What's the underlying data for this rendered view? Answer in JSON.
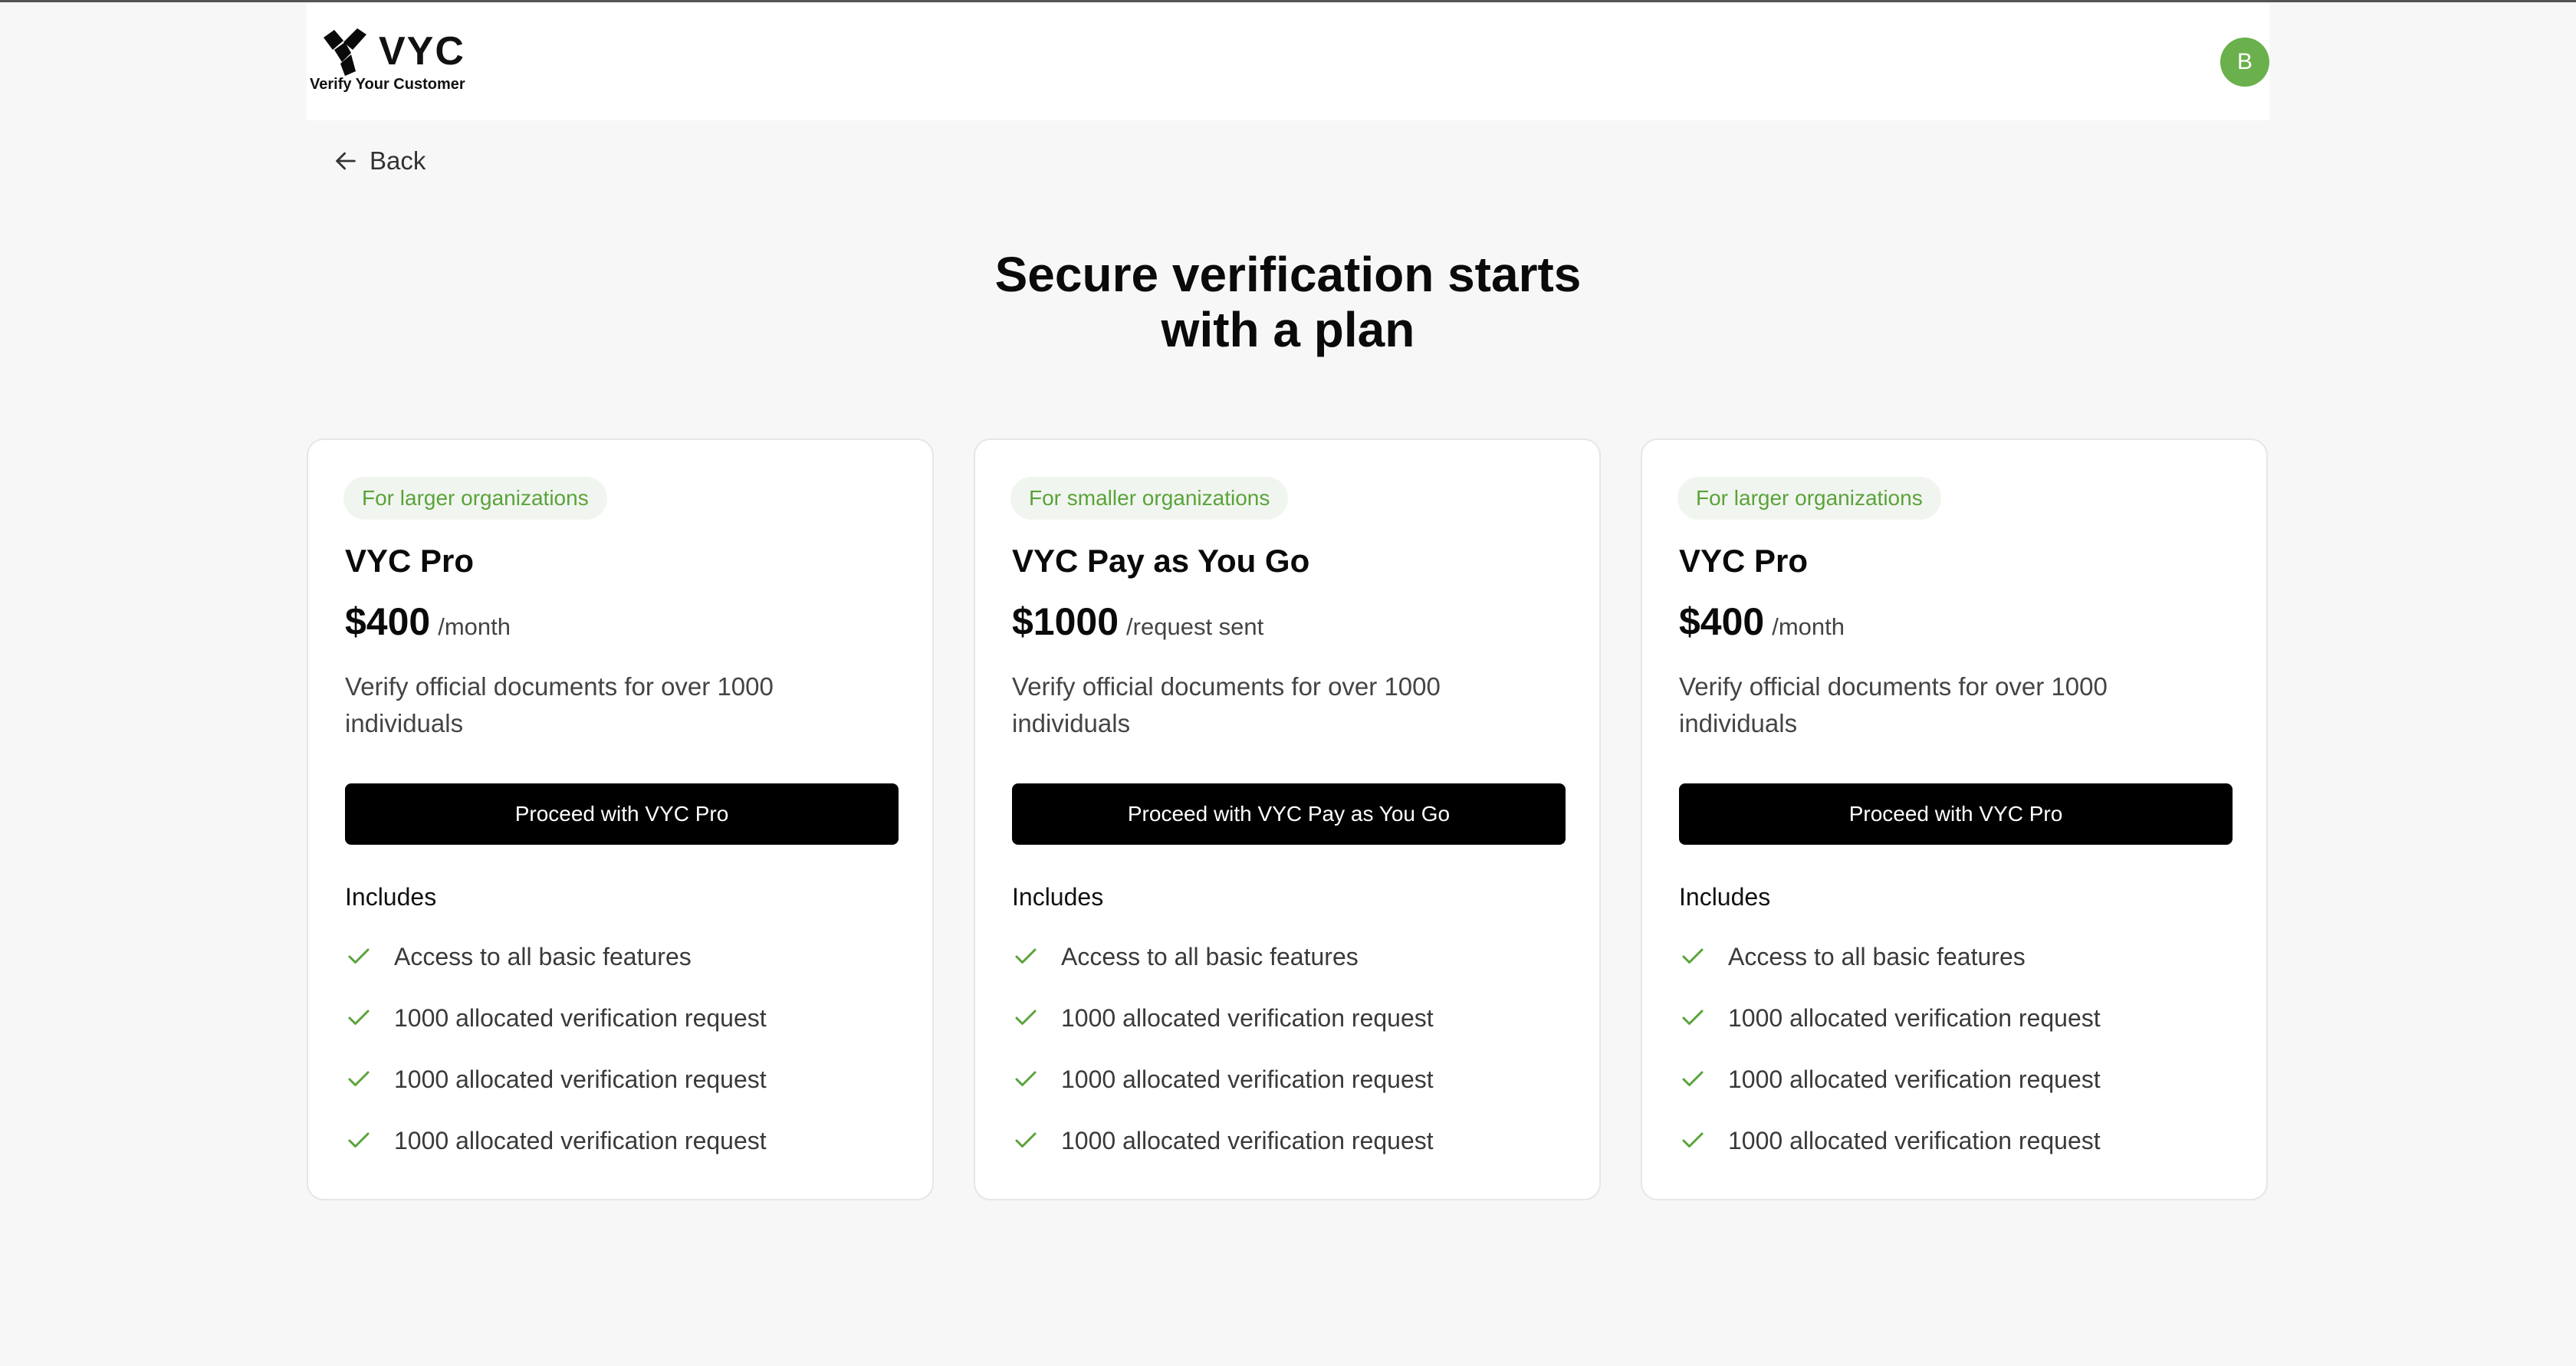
{
  "header": {
    "logo_text": "VYC",
    "tagline": "Verify Your Customer",
    "avatar_initial": "B"
  },
  "nav": {
    "back_label": "Back"
  },
  "page": {
    "title_line1": "Secure verification starts",
    "title_line2": "with a plan"
  },
  "colors": {
    "accent_green": "#6ab04c",
    "badge_text": "#5aa33a",
    "badge_bg": "#f1f5ef",
    "button_bg": "#000000"
  },
  "plans": [
    {
      "badge": "For larger organizations",
      "name": "VYC Pro",
      "price": "$400",
      "period": "/month",
      "description": "Verify official documents for over 1000 individuals",
      "cta": "Proceed with VYC Pro",
      "includes_title": "Includes",
      "features": [
        "Access to all basic features",
        "1000 allocated verification request",
        "1000 allocated verification request",
        "1000 allocated verification request"
      ]
    },
    {
      "badge": "For smaller organizations",
      "name": "VYC Pay as You Go",
      "price": "$1000",
      "period": "/request sent",
      "description": "Verify official documents for over 1000 individuals",
      "cta": "Proceed with VYC Pay as You Go",
      "includes_title": "Includes",
      "features": [
        "Access to all basic features",
        "1000 allocated verification request",
        "1000 allocated verification request",
        "1000 allocated verification request"
      ]
    },
    {
      "badge": "For larger organizations",
      "name": "VYC Pro",
      "price": "$400",
      "period": "/month",
      "description": "Verify official documents for over 1000 individuals",
      "cta": "Proceed with VYC Pro",
      "includes_title": "Includes",
      "features": [
        "Access to all basic features",
        "1000 allocated verification request",
        "1000 allocated verification request",
        "1000 allocated verification request"
      ]
    }
  ]
}
